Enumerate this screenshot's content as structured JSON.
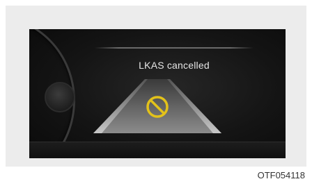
{
  "display": {
    "message": "LKAS cancelled",
    "icon": "no-entry-icon",
    "icon_color": "#e3c21a"
  },
  "caption": {
    "code": "OTF054118"
  }
}
